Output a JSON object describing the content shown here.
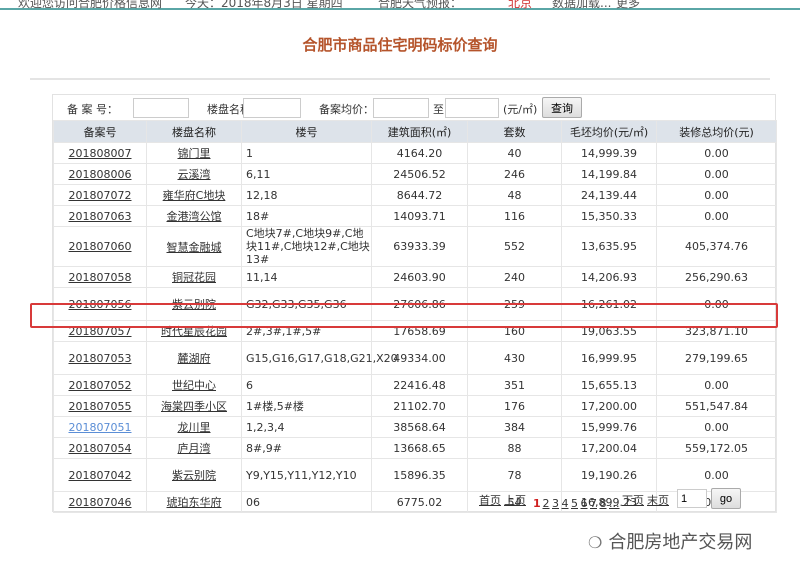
{
  "topbar": {
    "welcome": "欢迎您访问合肥价格信息网",
    "date": "今天：2018年8月3日 星期四",
    "weather": "合肥天气预报：",
    "city": "北京",
    "loading": "数据加载...",
    "more": "更多"
  },
  "title": "合肥市商品住宅明码标价查询",
  "filter": {
    "record_no_label": "备 案 号：",
    "project_label": "楼盘名称：",
    "price_label": "备案均价：",
    "to_label": "至",
    "unit": "(元/㎡)",
    "query_button": "查询",
    "record_no_value": "",
    "project_value": "",
    "price_min": "",
    "price_max": ""
  },
  "columns": [
    "备案号",
    "楼盘名称",
    "楼号",
    "建筑面积(㎡)",
    "套数",
    "毛坯均价(元/㎡)",
    "装修总均价(元)"
  ],
  "rows": [
    [
      "201808007",
      "锦门里",
      "1",
      "4164.20",
      "40",
      "14,999.39",
      "0.00"
    ],
    [
      "201808006",
      "云溪湾",
      "6,11",
      "24506.52",
      "246",
      "14,199.84",
      "0.00"
    ],
    [
      "201807072",
      "雍华府C地块",
      "12,18",
      "8644.72",
      "48",
      "24,139.44",
      "0.00"
    ],
    [
      "201807063",
      "金港湾公馆",
      "18#",
      "14093.71",
      "116",
      "15,350.33",
      "0.00"
    ],
    [
      "201807060",
      "智慧金融城",
      "C地块7#,C地块9#,C地块11#,C地块12#,C地块13#",
      "63933.39",
      "552",
      "13,635.95",
      "405,374.76"
    ],
    [
      "201807058",
      "铜冠花园",
      "11,14",
      "24603.90",
      "240",
      "14,206.93",
      "256,290.63"
    ],
    [
      "201807056",
      "紫云别院",
      "G32,G33,G35,G36",
      "27606.86",
      "259",
      "16,261.02",
      "0.00"
    ],
    [
      "201807057",
      "时代星辰花园",
      "2#,3#,1#,5#",
      "17658.69",
      "160",
      "19,063.55",
      "323,871.10"
    ],
    [
      "201807053",
      "麓湖府",
      "G15,G16,G17,G18,G21,X20",
      "49334.00",
      "430",
      "16,999.95",
      "279,199.65"
    ],
    [
      "201807052",
      "世纪中心",
      "6",
      "22416.48",
      "351",
      "15,655.13",
      "0.00"
    ],
    [
      "201807055",
      "海棠四季小区",
      "1#楼,5#楼",
      "21102.70",
      "176",
      "17,200.00",
      "551,547.84"
    ],
    [
      "201807051",
      "龙川里",
      "1,2,3,4",
      "38568.64",
      "384",
      "15,999.76",
      "0.00"
    ],
    [
      "201807054",
      "庐月湾",
      "8#,9#",
      "13668.65",
      "88",
      "17,200.04",
      "559,172.05"
    ],
    [
      "201807042",
      "紫云别院",
      "Y9,Y15,Y11,Y12,Y10",
      "15896.35",
      "78",
      "19,190.26",
      "0.00"
    ],
    [
      "201807046",
      "琥珀东华府",
      "06",
      "6775.02",
      "54",
      "16,899.23",
      "0.00"
    ]
  ],
  "highlighted_row": "201807057",
  "visited_row": "201807051",
  "pager": {
    "first": "首页",
    "prev": "上页",
    "pages": [
      "1",
      "2",
      "3",
      "4",
      "5",
      "6",
      "7",
      "8",
      "..."
    ],
    "current": "1",
    "next": "下页",
    "last": "末页",
    "page_input": "1",
    "go": "go"
  },
  "watermark": "合肥房地产交易网",
  "colors": {
    "title": "#b5542b",
    "header_bg": "#dde3ea",
    "highlight": "#d83a3a",
    "current_page": "#d02020"
  }
}
